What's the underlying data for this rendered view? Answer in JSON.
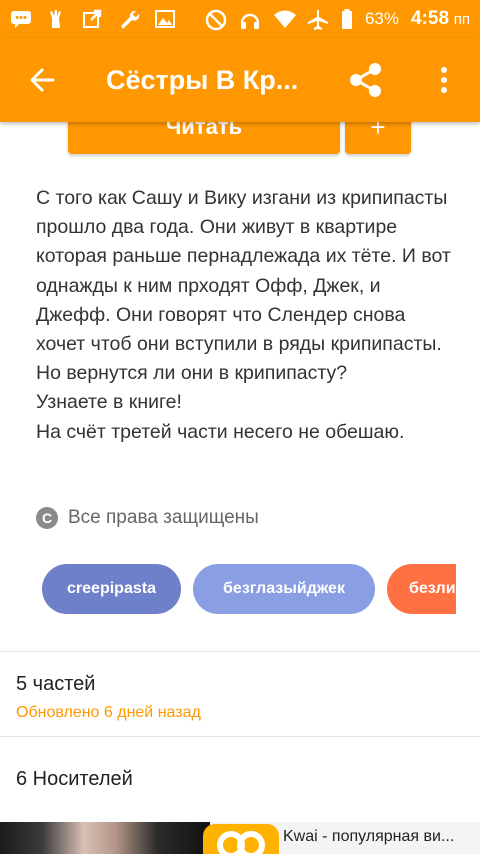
{
  "status_bar": {
    "battery_percent": "63%",
    "time": "4:58",
    "time_suffix": "пп"
  },
  "app_bar": {
    "title": "Сёстры В Кр..."
  },
  "actions": {
    "read_label": "Читать",
    "add_label": "+"
  },
  "story": {
    "description": "С того как Сашу и Вику изгани из крипипасты прошло два года. Они живут в квартире которая раньше пернадлежада их тёте.  И вот однажды к ним прходят Офф,  Джек, и Джефф. Они говорят что Слендер снова хочет чтоб они вступили в ряды крипипасты.  Но вернутся ли они в крипипасту?\nУзнаете в книге!\nНа счёт третей части несего не обешаю.",
    "copyright_symbol": "C",
    "copyright": "Все права защищены",
    "tags": [
      "creepipasta",
      "безглазыйджек",
      "безликий"
    ],
    "parts_count": "5 частей",
    "updated": "Обновлено 6 дней назад",
    "media_count": "6 Носителей"
  },
  "ad": {
    "text": "Kwai - популярная ви..."
  },
  "colors": {
    "accent": "#ff9800",
    "tag1": "#6e80c9",
    "tag2": "#8a9ee4",
    "tag3": "#ff7043"
  }
}
